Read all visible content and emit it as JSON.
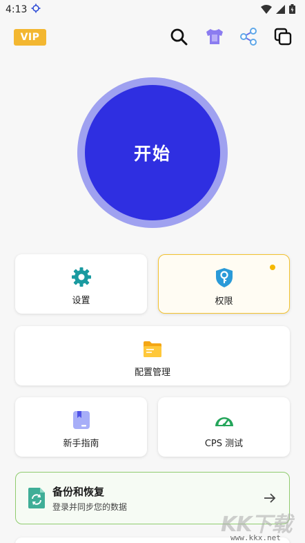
{
  "status_bar": {
    "time": "4:13"
  },
  "top_bar": {
    "vip_label": "VIP"
  },
  "start_button": {
    "label": "开始"
  },
  "cards": {
    "settings": "设置",
    "permissions": "权限",
    "config": "配置管理",
    "guide": "新手指南",
    "cps": "CPS 测试"
  },
  "backup": {
    "title": "备份和恢复",
    "subtitle": "登录并同步您的数据"
  },
  "watermark": {
    "brand": "KK下载",
    "url": "www.kkx.net"
  },
  "colors": {
    "start_inner": "#2f2fe1",
    "start_ring": "#9fa1f0",
    "vip": "#f3b731",
    "settings_icon": "#1a9aa0",
    "permission_icon": "#2a9ad8",
    "highlight_border": "#f3c22d",
    "backup_border": "#8fcb6d"
  },
  "icons": [
    "location-icon",
    "wifi-icon",
    "signal-icon",
    "battery-icon",
    "search-icon",
    "theme-shirt-icon",
    "share-icon",
    "copy-windows-icon",
    "gear-icon",
    "key-shield-icon",
    "folder-icon",
    "book-icon",
    "speedometer-icon",
    "backup-sync-icon",
    "arrow-right-icon"
  ]
}
